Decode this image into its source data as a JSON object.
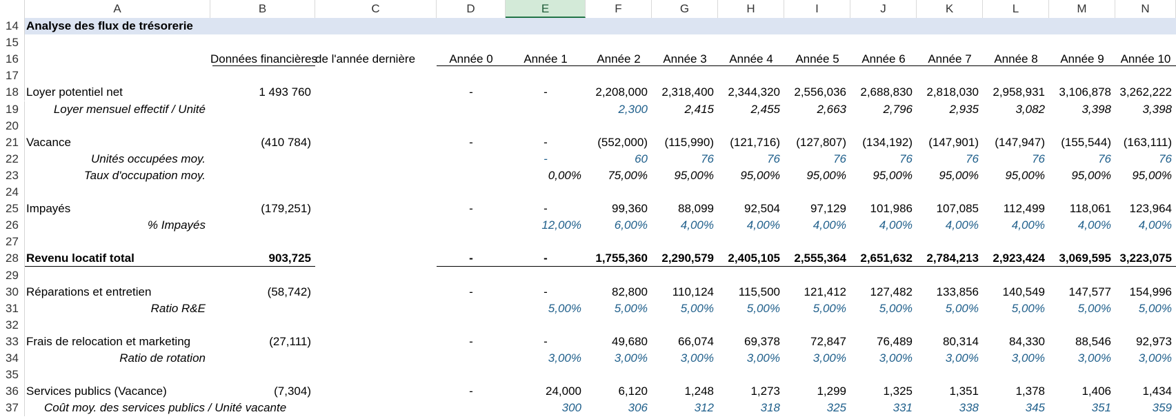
{
  "columns": [
    "A",
    "B",
    "C",
    "D",
    "E",
    "F",
    "G",
    "H",
    "I",
    "J",
    "K",
    "L",
    "M",
    "N"
  ],
  "selected_column": "E",
  "rows": [
    {
      "n": "14",
      "label": "Analyse des flux de trésorerie",
      "style": "banner"
    },
    {
      "n": "15"
    },
    {
      "n": "16",
      "header": {
        "B": "Données financières",
        "C": "de l'année dernière",
        "D": "Année 0",
        "E": "Année 1",
        "F": "Année 2",
        "G": "Année 3",
        "H": "Année 4",
        "I": "Année 5",
        "J": "Année 6",
        "K": "Année 7",
        "L": "Année 8",
        "M": "Année 9",
        "N": "Année 10"
      }
    },
    {
      "n": "17"
    },
    {
      "n": "18",
      "label": "Loyer potentiel net",
      "B": "1 493 760",
      "D": "-",
      "E": "-",
      "F": "2,208,000",
      "G": "2,318,400",
      "H": "2,344,320",
      "I": "2,556,036",
      "J": "2,688,830",
      "K": "2,818,030",
      "L": "2,958,931",
      "M": "3,106,878",
      "N": "3,262,222"
    },
    {
      "n": "19",
      "label": "Loyer mensuel effectif / Unité",
      "style": "italic-sub",
      "F": "2,300",
      "fblue": true,
      "G": "2,415",
      "H": "2,455",
      "I": "2,663",
      "J": "2,796",
      "K": "2,935",
      "L": "3,082",
      "M": "3,398",
      "N": "3,398"
    },
    {
      "n": "20"
    },
    {
      "n": "21",
      "label": "Vacance",
      "B": "(410 784)",
      "D": "-",
      "E": "-",
      "F": "(552,000)",
      "G": "(115,990)",
      "H": "(121,716)",
      "I": "(127,807)",
      "J": "(134,192)",
      "K": "(147,901)",
      "L": "(147,947)",
      "M": "(155,544)",
      "N": "(163,111)"
    },
    {
      "n": "22",
      "label": "Unités occupées moy.",
      "style": "italic-sub",
      "blue": true,
      "E": "-",
      "F": "60",
      "G": "76",
      "H": "76",
      "I": "76",
      "J": "76",
      "K": "76",
      "L": "76",
      "M": "76",
      "N": "76"
    },
    {
      "n": "23",
      "label": "Taux d'occupation moy.",
      "style": "italic-sub",
      "E": "0,00%",
      "F": "75,00%",
      "G": "95,00%",
      "H": "95,00%",
      "I": "95,00%",
      "J": "95,00%",
      "K": "95,00%",
      "L": "95,00%",
      "M": "95,00%",
      "N": "95,00%"
    },
    {
      "n": "24"
    },
    {
      "n": "25",
      "label": "Impayés",
      "B": "(179,251)",
      "D": "-",
      "E": "-",
      "F": "99,360",
      "G": "88,099",
      "H": "92,504",
      "I": "97,129",
      "J": "101,986",
      "K": "107,085",
      "L": "112,499",
      "M": "118,061",
      "N": "123,964"
    },
    {
      "n": "26",
      "label": "% Impayés",
      "style": "italic-sub",
      "blue": true,
      "E": "12,00%",
      "F": "6,00%",
      "G": "4,00%",
      "H": "4,00%",
      "I": "4,00%",
      "J": "4,00%",
      "K": "4,00%",
      "L": "4,00%",
      "M": "4,00%",
      "N": "4,00%"
    },
    {
      "n": "27"
    },
    {
      "n": "28",
      "label": "Revenu locatif total",
      "style": "bold",
      "B": "903,725",
      "D": "-",
      "E": "-",
      "F": "1,755,360",
      "G": "2,290,579",
      "H": "2,405,105",
      "I": "2,555,364",
      "J": "2,651,632",
      "K": "2,784,213",
      "L": "2,923,424",
      "M": "3,069,595",
      "N": "3,223,075"
    },
    {
      "n": "29"
    },
    {
      "n": "30",
      "label": "Réparations et entretien",
      "B": "(58,742)",
      "D": "-",
      "E": "-",
      "F": "82,800",
      "G": "110,124",
      "H": "115,500",
      "I": "121,412",
      "J": "127,482",
      "K": "133,856",
      "L": "140,549",
      "M": "147,577",
      "N": "154,996"
    },
    {
      "n": "31",
      "label": "Ratio R&E",
      "style": "italic-sub",
      "blue": true,
      "E": "5,00%",
      "F": "5,00%",
      "G": "5,00%",
      "H": "5,00%",
      "I": "5,00%",
      "J": "5,00%",
      "K": "5,00%",
      "L": "5,00%",
      "M": "5,00%",
      "N": "5,00%"
    },
    {
      "n": "32"
    },
    {
      "n": "33",
      "label": "Frais de relocation et marketing",
      "B": "(27,111)",
      "D": "-",
      "E": "-",
      "F": "49,680",
      "G": "66,074",
      "H": "69,378",
      "I": "72,847",
      "J": "76,489",
      "K": "80,314",
      "L": "84,330",
      "M": "88,546",
      "N": "92,973"
    },
    {
      "n": "34",
      "label": "Ratio de rotation",
      "style": "italic-sub",
      "blue": true,
      "E": "3,00%",
      "F": "3,00%",
      "G": "3,00%",
      "H": "3,00%",
      "I": "3,00%",
      "J": "3,00%",
      "K": "3,00%",
      "L": "3,00%",
      "M": "3,00%",
      "N": "3,00%"
    },
    {
      "n": "35"
    },
    {
      "n": "36",
      "label": "Services publics (Vacance)",
      "B": "(7,304)",
      "D": "-",
      "E": "24,000",
      "F": "6,120",
      "G": "1,248",
      "H": "1,273",
      "I": "1,299",
      "J": "1,325",
      "K": "1,351",
      "L": "1,378",
      "M": "1,406",
      "N": "1,434"
    },
    {
      "n": "37",
      "label": "Coût moy. des services publics / Unité vacante",
      "style": "italic-sub-left",
      "blue": true,
      "E": "300",
      "F": "306",
      "G": "312",
      "H": "318",
      "I": "325",
      "J": "331",
      "K": "338",
      "L": "345",
      "M": "351",
      "N": "359"
    }
  ],
  "colors": {
    "banner": "#dce4f2",
    "input_blue": "#1f5f8b",
    "selected_header": "#d3ead8"
  }
}
